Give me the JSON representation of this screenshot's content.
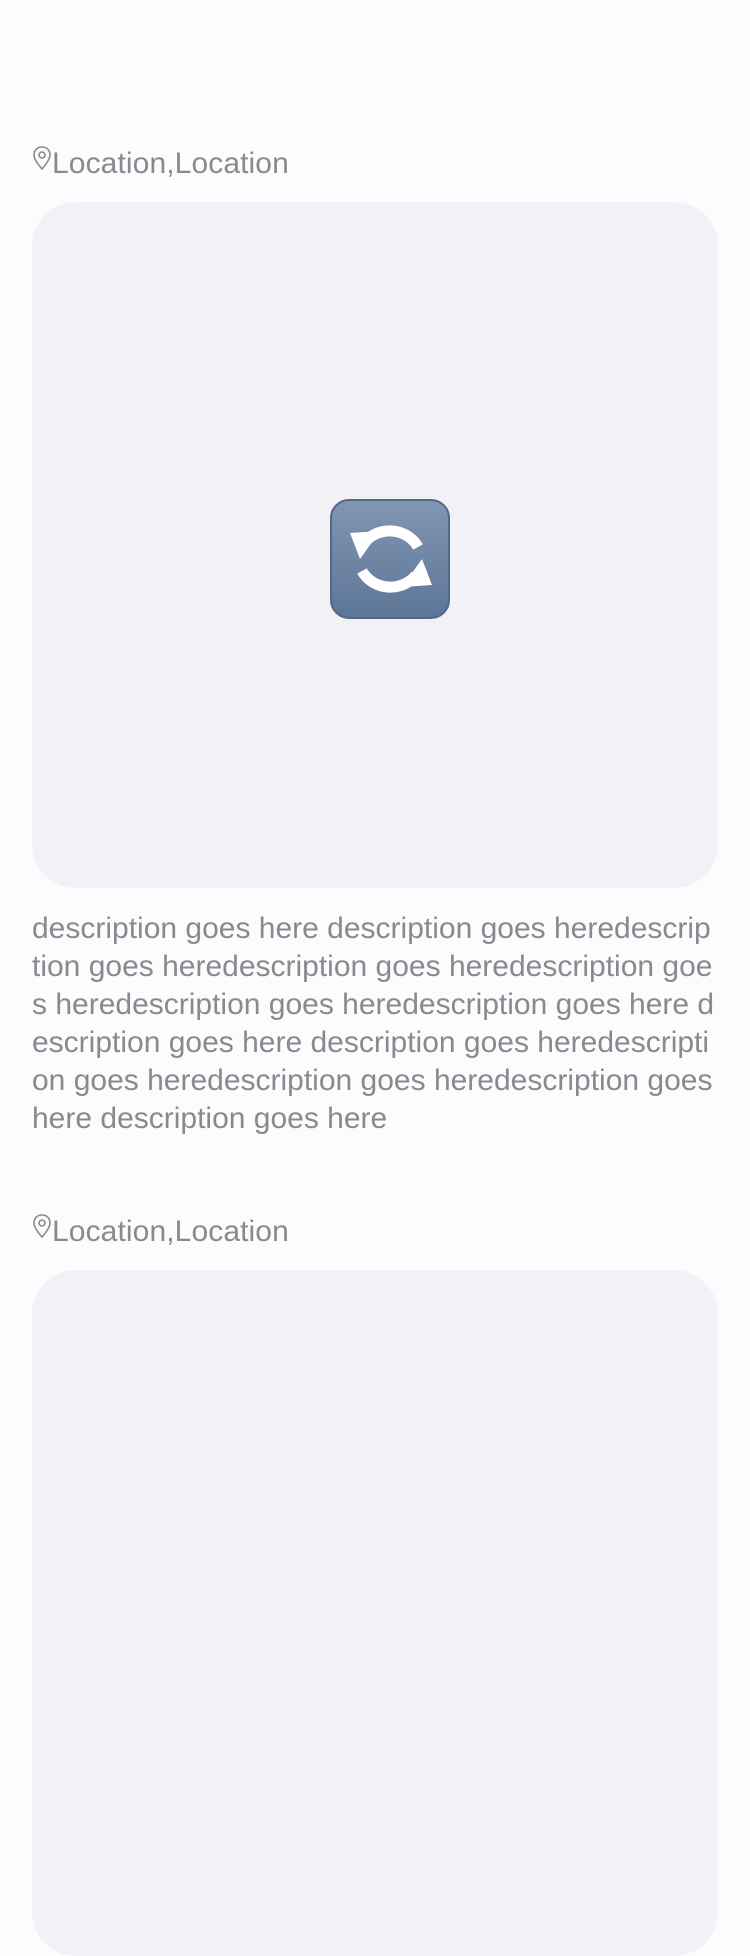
{
  "feed": {
    "posts": [
      {
        "location": "Location,Location",
        "media_icon": "refresh-icon",
        "description": "description goes here description goes heredescription goes heredescription goes heredescription goes heredescription goes heredescription goes here description goes here description goes heredescription goes heredescription goes heredescription goes here description goes here"
      },
      {
        "location": "Location,Location",
        "media_icon": "",
        "description": ""
      }
    ]
  },
  "colors": {
    "background": "#fcfbfd",
    "card": "#f2f1f6",
    "secondary_text": "#8a8a8e",
    "icon_tile": "#6c84a4"
  }
}
